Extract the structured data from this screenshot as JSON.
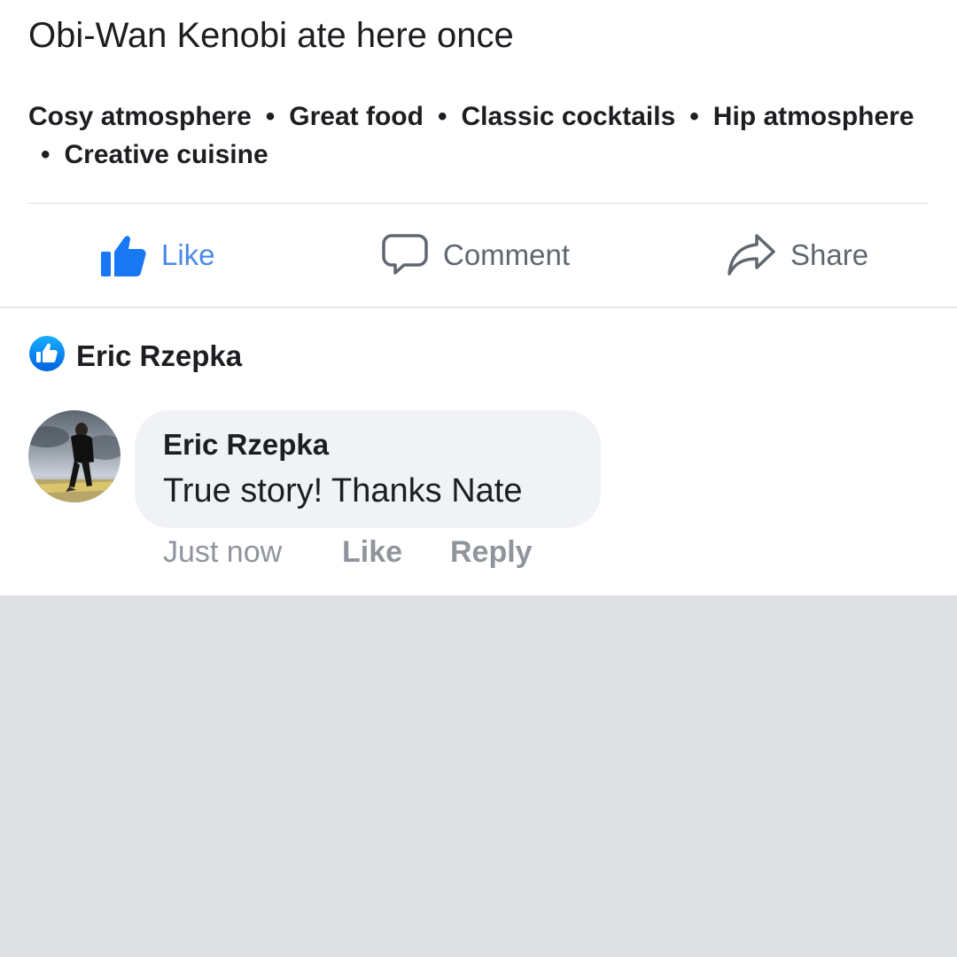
{
  "post": {
    "text": "Obi-Wan Kenobi ate here once",
    "tags": [
      "Cosy atmosphere",
      "Great food",
      "Classic cocktails",
      "Hip atmosphere",
      "Creative cuisine"
    ],
    "tag_separator": "•"
  },
  "actions": {
    "like_label": "Like",
    "comment_label": "Comment",
    "share_label": "Share",
    "like_color": "#4a89e8",
    "icons": [
      "thumbs-up-icon",
      "speech-bubble-icon",
      "share-arrow-icon"
    ]
  },
  "reactions": {
    "liker_name": "Eric Rzepka",
    "icon": "like-badge-icon"
  },
  "comment": {
    "author": "Eric Rzepka",
    "text": "True story!  Thanks Nate",
    "time": "Just now",
    "like_label": "Like",
    "reply_label": "Reply"
  },
  "colors": {
    "accent": "#1877f2",
    "text": "#1c1e21",
    "muted": "#90949c",
    "bubble": "#f0f2f5",
    "background": "#dddfe3"
  }
}
